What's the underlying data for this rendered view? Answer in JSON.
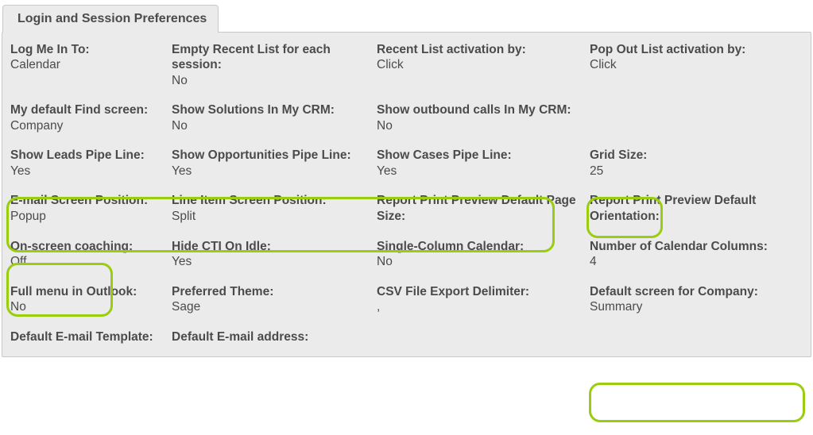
{
  "tab_title": "Login and Session Preferences",
  "rows": [
    [
      {
        "label": "Log Me In To:",
        "value": "Calendar"
      },
      {
        "label": "Empty Recent List for each session:",
        "value": "No"
      },
      {
        "label": "Recent List activation by:",
        "value": "Click"
      },
      {
        "label": "Pop Out List activation by:",
        "value": "Click"
      }
    ],
    [
      {
        "label": "My default Find screen:",
        "value": "Company"
      },
      {
        "label": "Show Solutions In My CRM:",
        "value": "No"
      },
      {
        "label": "Show outbound calls In My CRM:",
        "value": "No"
      },
      {
        "label": "",
        "value": ""
      }
    ],
    [
      {
        "label": "Show Leads Pipe Line:",
        "value": "Yes"
      },
      {
        "label": "Show Opportunities Pipe Line:",
        "value": "Yes"
      },
      {
        "label": "Show Cases Pipe Line:",
        "value": "Yes"
      },
      {
        "label": "Grid Size:",
        "value": "25"
      }
    ],
    [
      {
        "label": "E-mail Screen Position:",
        "value": "Popup"
      },
      {
        "label": "Line Item Screen Position:",
        "value": "Split"
      },
      {
        "label": "Report Print Preview Default Page Size:",
        "value": ""
      },
      {
        "label": "Report Print Preview Default Orientation:",
        "value": ""
      }
    ],
    [
      {
        "label": "On-screen coaching:",
        "value": "Off"
      },
      {
        "label": "Hide CTI On Idle:",
        "value": "Yes"
      },
      {
        "label": "Single-Column Calendar:",
        "value": "No"
      },
      {
        "label": "Number of Calendar Columns:",
        "value": "4"
      }
    ],
    [
      {
        "label": "Full menu in Outlook:",
        "value": "No"
      },
      {
        "label": "Preferred Theme:",
        "value": "Sage"
      },
      {
        "label": "CSV File Export Delimiter:",
        "value": ","
      },
      {
        "label": "Default screen for Company:",
        "value": "Summary"
      }
    ],
    [
      {
        "label": "Default E-mail Template:",
        "value": ""
      },
      {
        "label": "Default E-mail address:",
        "value": ""
      },
      {
        "label": "",
        "value": ""
      },
      {
        "label": "",
        "value": ""
      }
    ]
  ]
}
